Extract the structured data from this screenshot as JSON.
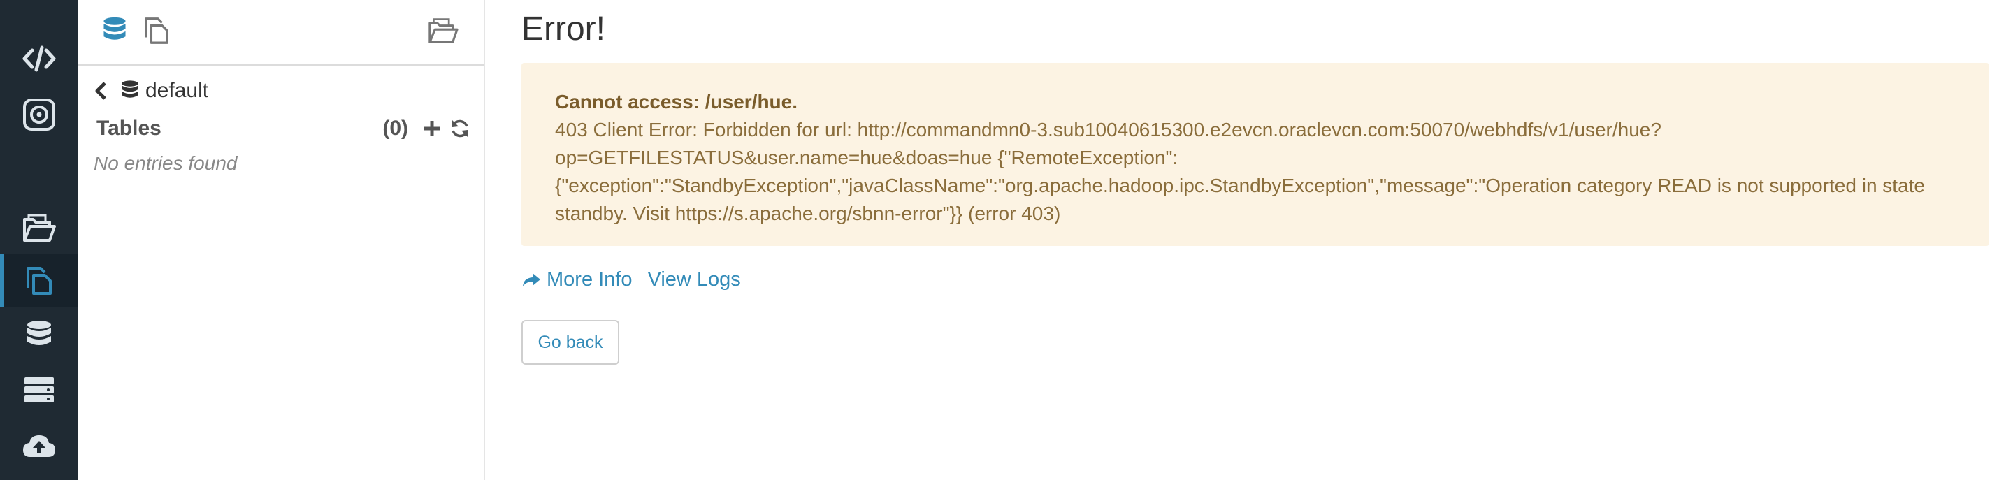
{
  "rail": {
    "items": [
      {
        "name": "editor",
        "icon": "code-icon"
      },
      {
        "name": "dashboard",
        "icon": "target-icon"
      },
      {
        "name": "files",
        "icon": "folder-open-icon"
      },
      {
        "name": "documents",
        "icon": "copy-icon",
        "active": true
      },
      {
        "name": "tables",
        "icon": "database-icon"
      },
      {
        "name": "jobs",
        "icon": "server-icon"
      },
      {
        "name": "upload",
        "icon": "cloud-upload-icon"
      }
    ],
    "colors": {
      "background": "#1f2a33",
      "icon": "#dce4ea",
      "active_icon": "#338bb8"
    }
  },
  "panel": {
    "breadcrumb": {
      "database": "default"
    },
    "tables": {
      "title": "Tables",
      "count": "(0)"
    },
    "empty_message": "No entries found"
  },
  "main": {
    "title": "Error!",
    "alert": {
      "heading": "Cannot access: /user/hue.",
      "message": "403 Client Error: Forbidden for url: http://commandmn0-3.sub10040615300.e2evcn.oraclevcn.com:50070/webhdfs/v1/user/hue?op=GETFILESTATUS&user.name=hue&doas=hue {\"RemoteException\":{\"exception\":\"StandbyException\",\"javaClassName\":\"org.apache.hadoop.ipc.StandbyException\",\"message\":\"Operation category READ is not supported in state standby. Visit https://s.apache.org/sbnn-error\"}} (error 403)"
    },
    "links": {
      "more_info": "More Info",
      "view_logs": "View Logs"
    },
    "go_back": "Go back",
    "colors": {
      "accent": "#338bb8",
      "alert_bg": "#fcf3e3",
      "alert_text": "#8a6d3b"
    }
  }
}
